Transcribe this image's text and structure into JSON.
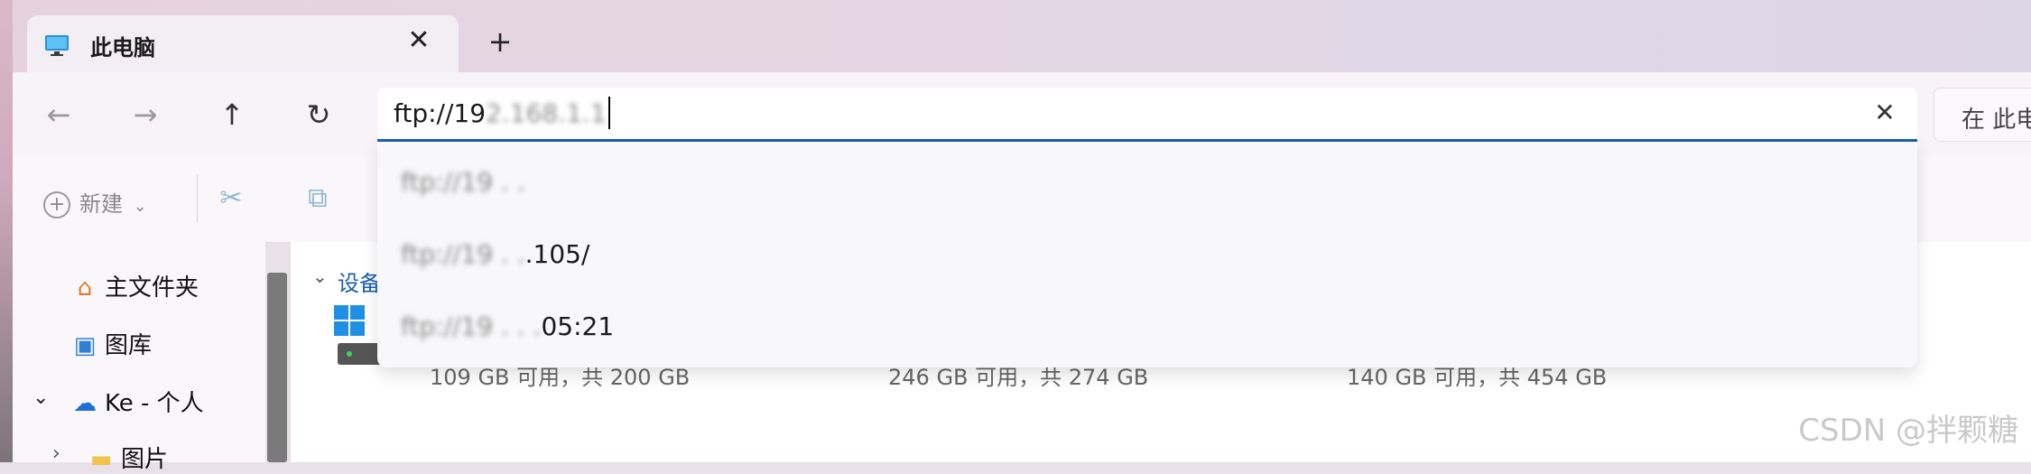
{
  "tab": {
    "title": "此电脑",
    "close": "✕",
    "new_tab": "+",
    "icon": "monitor-icon"
  },
  "nav": {
    "back": "←",
    "forward": "→",
    "up": "↑",
    "refresh": "↻"
  },
  "address": {
    "prefix": "ftp://19",
    "obscured": "2.168.1.1",
    "clear": "✕"
  },
  "search": {
    "label": "在 此电"
  },
  "toolbar": {
    "new_label": "新建",
    "new_caret": "⌄",
    "cut_icon": "✂",
    "copy_icon": "⧉"
  },
  "sidebar": {
    "items": [
      {
        "icon": "home-icon",
        "glyph": "⌂",
        "label": "主文件夹"
      },
      {
        "icon": "gallery-icon",
        "glyph": "▣",
        "label": "图库"
      },
      {
        "icon": "onedrive-icon",
        "glyph": "☁",
        "label": "Ke - 个人",
        "chevron": "⌄"
      },
      {
        "icon": "folder-icon",
        "glyph": "▬",
        "label": "图片",
        "chevron": "›"
      }
    ]
  },
  "main": {
    "section_label": "设备",
    "section_chevron": "⌄",
    "drives": [
      {
        "info": "109 GB 可用，共 200 GB"
      },
      {
        "info": "246 GB 可用，共 274 GB"
      },
      {
        "info": "140 GB 可用，共 454 GB"
      }
    ]
  },
  "suggestions": [
    {
      "blurred": "ftp://19 .  . ",
      "visible": ""
    },
    {
      "blurred": "ftp://19 .  .",
      "visible": ".105/"
    },
    {
      "blurred": "ftp://19 .  .  .",
      "visible": "05:21"
    }
  ],
  "watermark": "CSDN @拌颗糖",
  "colors": {
    "accent": "#1a5fb4",
    "tab_bg": "#f3eef4",
    "page_bg": "#ffffff"
  }
}
